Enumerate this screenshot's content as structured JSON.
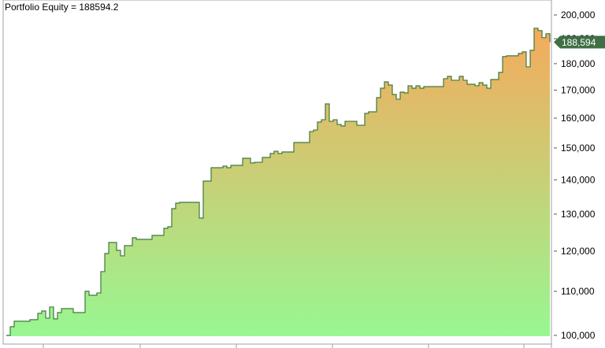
{
  "title": "Portfolio Equity = 188594.2",
  "chart_data": {
    "type": "area",
    "title": "Portfolio Equity = 188594.2",
    "xlabel": "",
    "ylabel": "",
    "yscale": "log",
    "ylim": [
      100000,
      200000
    ],
    "yticks": [
      100000,
      110000,
      120000,
      130000,
      140000,
      150000,
      160000,
      170000,
      180000,
      190000,
      200000
    ],
    "ytick_labels": [
      "100,000",
      "110,000",
      "120,000",
      "130,000",
      "140,000",
      "150,000",
      "160,000",
      "170,000",
      "180,000",
      "190,000",
      "200,000"
    ],
    "last_value": 188594.2,
    "last_value_label": "188,594",
    "colors": {
      "line": "#3d7a3d",
      "fill_bottom": "#98f792",
      "fill_top": "#f5aa5c",
      "marker": "#3f6f45"
    },
    "grid": false,
    "values": [
      100000,
      101890,
      103110,
      103110,
      103110,
      103110,
      103460,
      103460,
      104880,
      105420,
      103810,
      106330,
      103640,
      105060,
      105960,
      105960,
      105960,
      105060,
      105060,
      105060,
      110010,
      109070,
      109070,
      109620,
      114800,
      119380,
      122260,
      122260,
      120200,
      118780,
      121430,
      121430,
      123510,
      123090,
      123090,
      123090,
      123090,
      124140,
      124140,
      124140,
      126060,
      126490,
      131550,
      133130,
      133350,
      133350,
      133350,
      133350,
      133350,
      128890,
      139620,
      139620,
      143720,
      143720,
      143720,
      144220,
      143720,
      144460,
      144460,
      144460,
      146690,
      146690,
      145200,
      145440,
      145440,
      146940,
      146940,
      148200,
      148950,
      148200,
      148700,
      148700,
      148700,
      151780,
      151780,
      151780,
      151780,
      155430,
      155960,
      158640,
      159450,
      164990,
      158910,
      159450,
      157830,
      157300,
      158910,
      158910,
      158910,
      157560,
      157560,
      161650,
      162200,
      162200,
      167260,
      170710,
      173050,
      171870,
      168400,
      166700,
      169260,
      168970,
      171590,
      170710,
      171590,
      170710,
      171290,
      171290,
      171290,
      171290,
      171290,
      174240,
      175130,
      173650,
      173650,
      175130,
      173650,
      172170,
      172170,
      171590,
      172760,
      171870,
      170710,
      173940,
      173940,
      176630,
      182780,
      183090,
      183090,
      183090,
      184030,
      184660,
      178750,
      185290,
      194350,
      193360,
      190420,
      192050,
      188594.2
    ]
  }
}
